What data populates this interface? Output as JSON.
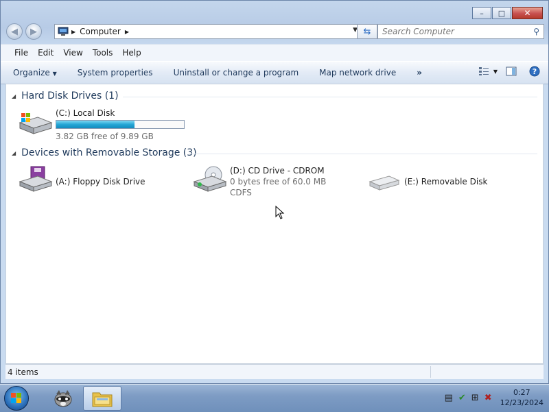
{
  "window": {
    "caption_buttons": {
      "minimize": "–",
      "maximize": "□",
      "close": "✕"
    }
  },
  "address_bar": {
    "crumbs": [
      "Computer"
    ],
    "search_placeholder": "Search Computer"
  },
  "menu": [
    "File",
    "Edit",
    "View",
    "Tools",
    "Help"
  ],
  "command_bar": {
    "organize": "Organize",
    "items": [
      "System properties",
      "Uninstall or change a program",
      "Map network drive"
    ],
    "more": "»"
  },
  "groups": {
    "hard_disks": {
      "title": "Hard Disk Drives (1)",
      "drives": [
        {
          "name": "(C:) Local Disk",
          "free_text": "3.82 GB free of 9.89 GB",
          "used_fraction": 0.614
        }
      ]
    },
    "removable": {
      "title": "Devices with Removable Storage (3)",
      "drives": [
        {
          "name": "(A:) Floppy Disk Drive"
        },
        {
          "name": "(D:) CD Drive - CDROM",
          "free_text": "0 bytes free of 60.0 MB",
          "fs": "CDFS"
        },
        {
          "name": "(E:) Removable Disk"
        }
      ]
    }
  },
  "status": {
    "items_count": "4 items"
  },
  "taskbar": {
    "time": "0:27",
    "date": "12/23/2024"
  },
  "colors": {
    "accent": "#25a6d6",
    "link": "#1e395b"
  }
}
